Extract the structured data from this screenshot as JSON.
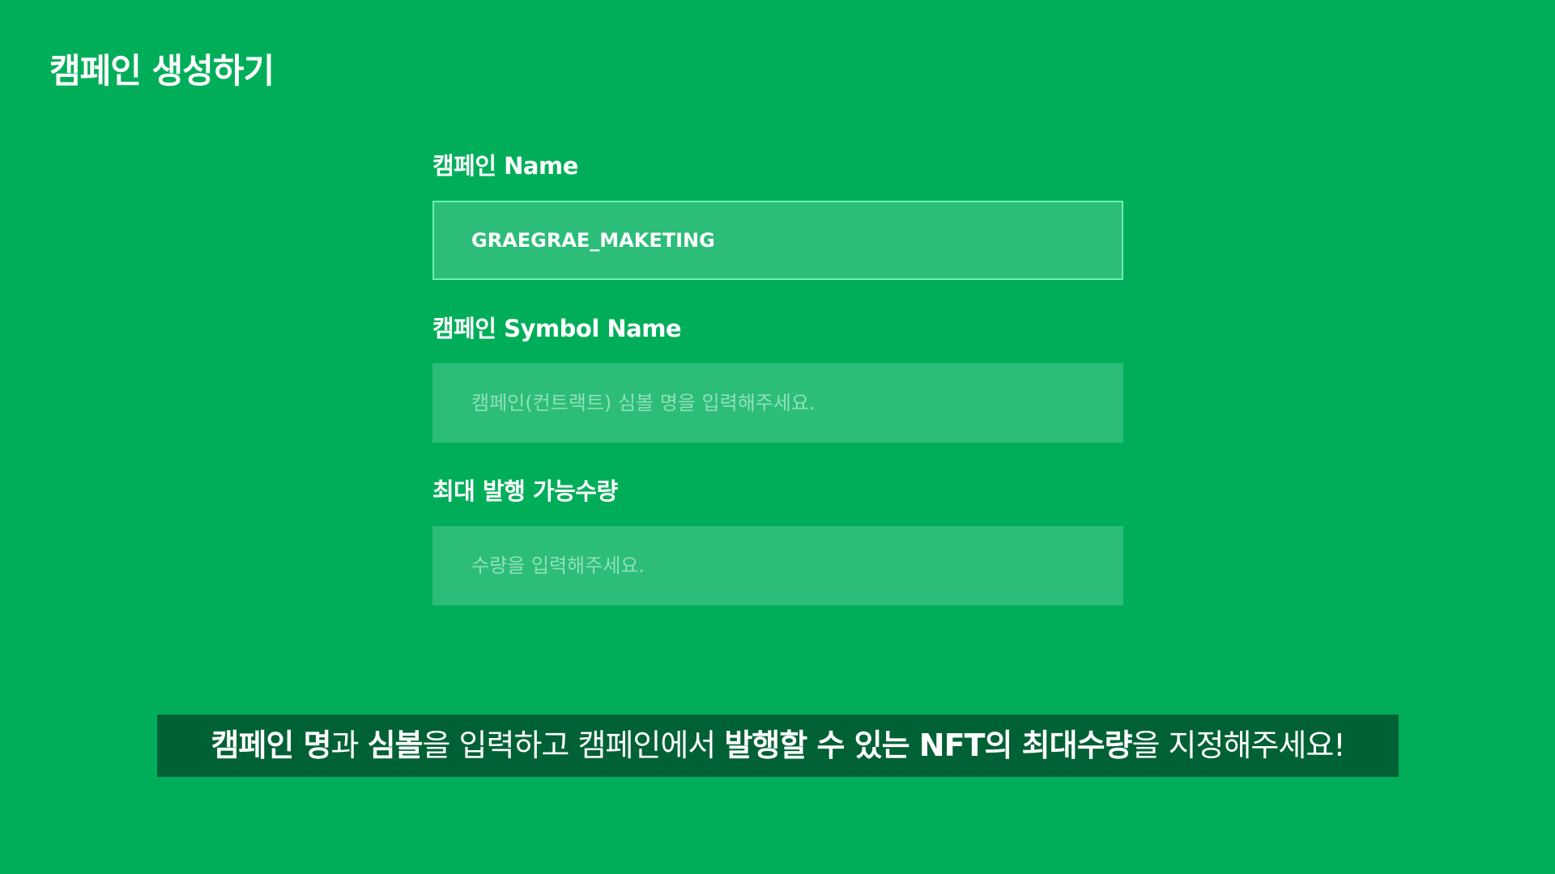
{
  "page": {
    "title": "캠페인 생성하기"
  },
  "form": {
    "fields": [
      {
        "label": "캠페인 Name",
        "value": "GRAEGRAE_MAKETING",
        "placeholder": ""
      },
      {
        "label": "캠페인 Symbol Name",
        "value": "",
        "placeholder": "캠페인(컨트랙트) 심볼 명을 입력해주세요."
      },
      {
        "label": "최대 발행 가능수량",
        "value": "",
        "placeholder": "수량을 입력해주세요."
      }
    ]
  },
  "caption": {
    "segments": [
      {
        "text": "캠페인 명",
        "bold": true
      },
      {
        "text": "과 ",
        "bold": false
      },
      {
        "text": "심볼",
        "bold": true
      },
      {
        "text": "을 입력하고 캠페인에서 ",
        "bold": false
      },
      {
        "text": "발행할 수 있는 NFT의 최대수량",
        "bold": true
      },
      {
        "text": "을 지정해주세요!",
        "bold": false
      }
    ]
  },
  "colors": {
    "background": "#00ae5a",
    "input_background": "#2cbd79",
    "input_focus_border": "#6df0b2",
    "caption_background": "#006135",
    "text": "#ffffff"
  }
}
